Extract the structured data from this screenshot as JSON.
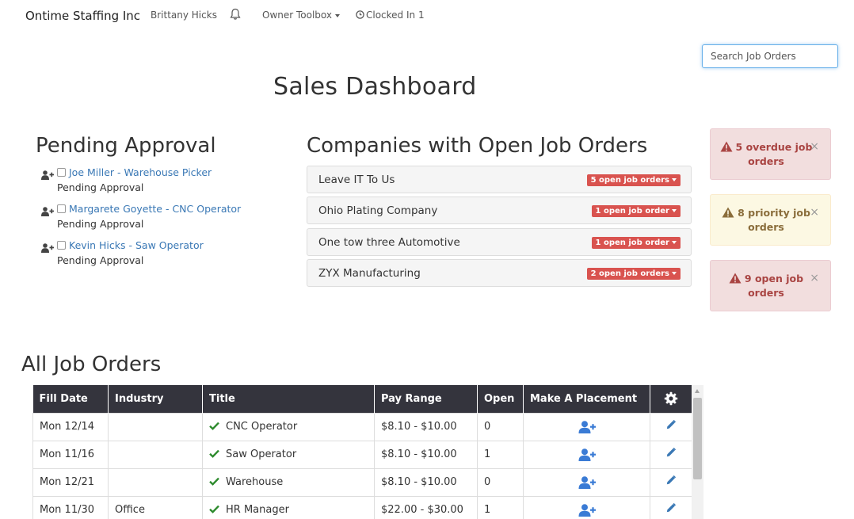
{
  "nav": {
    "brand": "Ontime Staffing Inc",
    "user": "Brittany Hicks",
    "toolbox": "Owner Toolbox",
    "clocked": "Clocked In 1"
  },
  "search": {
    "placeholder": "Search Job Orders"
  },
  "page_title": "Sales Dashboard",
  "pending": {
    "title": "Pending Approval",
    "items": [
      {
        "name": "Joe Miller - Warehouse Picker",
        "status": "Pending Approval"
      },
      {
        "name": "Margarete Goyette - CNC Operator",
        "status": "Pending Approval"
      },
      {
        "name": "Kevin Hicks - Saw Operator",
        "status": "Pending Approval"
      }
    ]
  },
  "companies": {
    "title": "Companies with Open Job Orders",
    "items": [
      {
        "name": "Leave IT To Us",
        "badge": "5 open job orders"
      },
      {
        "name": "Ohio Plating Company",
        "badge": "1 open job order"
      },
      {
        "name": "One tow three Automotive",
        "badge": "1 open job order"
      },
      {
        "name": "ZYX Manufacturing",
        "badge": "2 open job orders"
      }
    ]
  },
  "alerts": [
    {
      "text": "5 overdue job orders",
      "type": "danger",
      "close": "×"
    },
    {
      "text": "8 priority job orders",
      "type": "warning",
      "close": "×"
    },
    {
      "text": "9 open job orders",
      "type": "danger",
      "close": "×"
    }
  ],
  "job_orders": {
    "title": "All Job Orders",
    "headers": {
      "fill_date": "Fill Date",
      "industry": "Industry",
      "title": "Title",
      "pay_range": "Pay Range",
      "open": "Open",
      "placement": "Make A Placement"
    },
    "rows": [
      {
        "fill_date": "Mon 12/14",
        "industry": "",
        "title": "CNC Operator",
        "pay_range": "$8.10 - $10.00",
        "open": "0"
      },
      {
        "fill_date": "Mon 11/16",
        "industry": "",
        "title": "Saw Operator",
        "pay_range": "$8.10 - $10.00",
        "open": "1"
      },
      {
        "fill_date": "Mon 12/21",
        "industry": "",
        "title": "Warehouse",
        "pay_range": "$8.10 - $10.00",
        "open": "0"
      },
      {
        "fill_date": "Mon 11/30",
        "industry": "Office",
        "title": "HR Manager",
        "pay_range": "$22.00 - $30.00",
        "open": "1"
      }
    ]
  },
  "colors": {
    "link": "#3a78b5",
    "badge_red": "#d9534f",
    "table_header": "#34343d",
    "check_green": "#2c8a2c",
    "place_blue": "#3a7bd5"
  }
}
